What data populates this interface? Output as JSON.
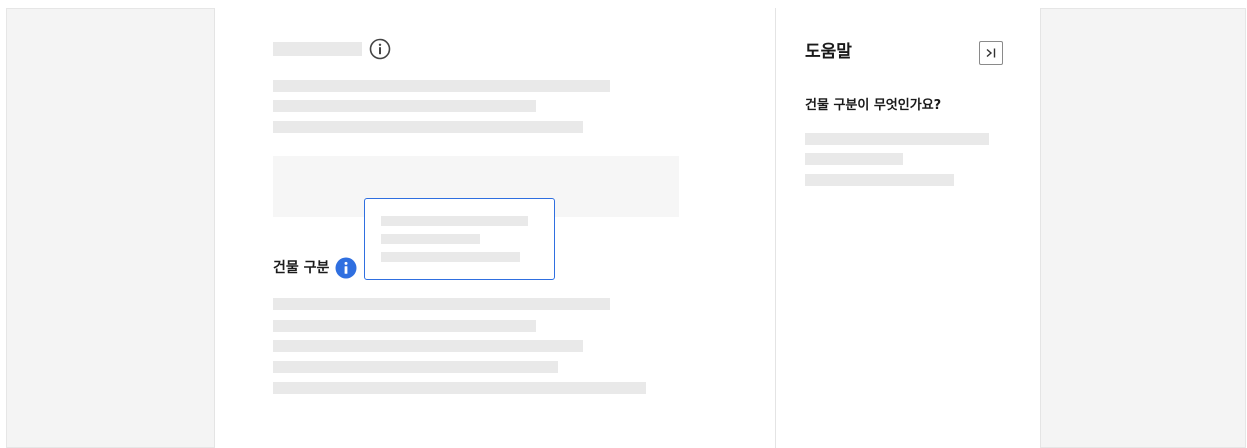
{
  "main": {
    "field_label": "건물 구분",
    "title_info_icon": "info-outline-icon",
    "field_info_icon": "info-filled-icon"
  },
  "help": {
    "title": "도움말",
    "question": "건물 구분이 무엇인가요?",
    "collapse_icon": "collapse-right-icon"
  },
  "colors": {
    "accent": "#2f6fe0",
    "skeleton": "#e9e9e9",
    "background": "#f4f4f4"
  }
}
